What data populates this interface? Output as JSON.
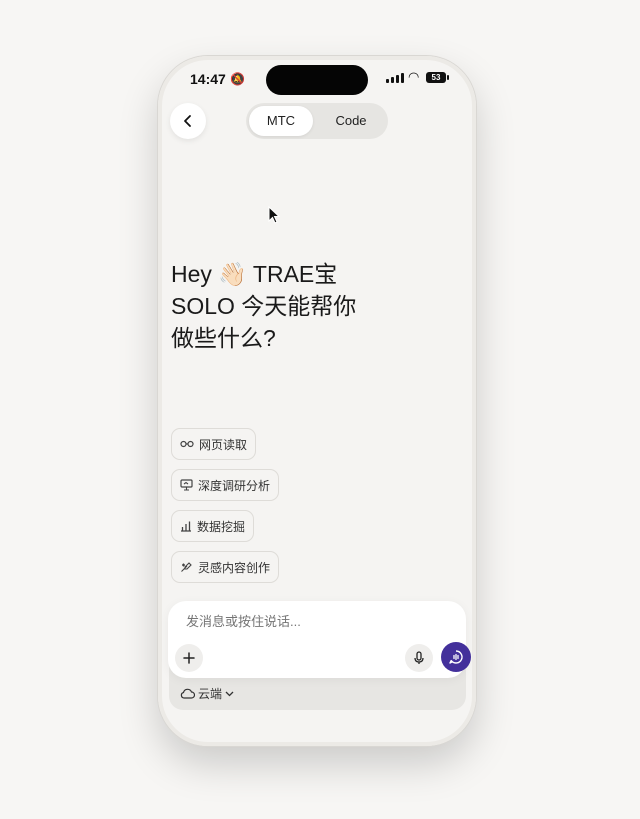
{
  "status_bar": {
    "time": "14:47",
    "battery": "53"
  },
  "header": {
    "tabs": [
      {
        "label": "MTC",
        "active": true
      },
      {
        "label": "Code",
        "active": false
      }
    ]
  },
  "greeting": {
    "line1": "Hey 👋🏻 TRAE宝",
    "line2": "SOLO 今天能帮你",
    "line3": "做些什么?"
  },
  "suggestions": [
    {
      "label": "网页读取",
      "icon": "glasses-icon"
    },
    {
      "label": "深度调研分析",
      "icon": "presentation-icon"
    },
    {
      "label": "数据挖掘",
      "icon": "bar-chart-icon"
    },
    {
      "label": "灵感内容创作",
      "icon": "sparkle-pen-icon"
    }
  ],
  "composer": {
    "placeholder": "发消息或按住说话...",
    "mode_label": "云端"
  },
  "colors": {
    "accent": "#43309b",
    "background": "#f5f4f2"
  }
}
